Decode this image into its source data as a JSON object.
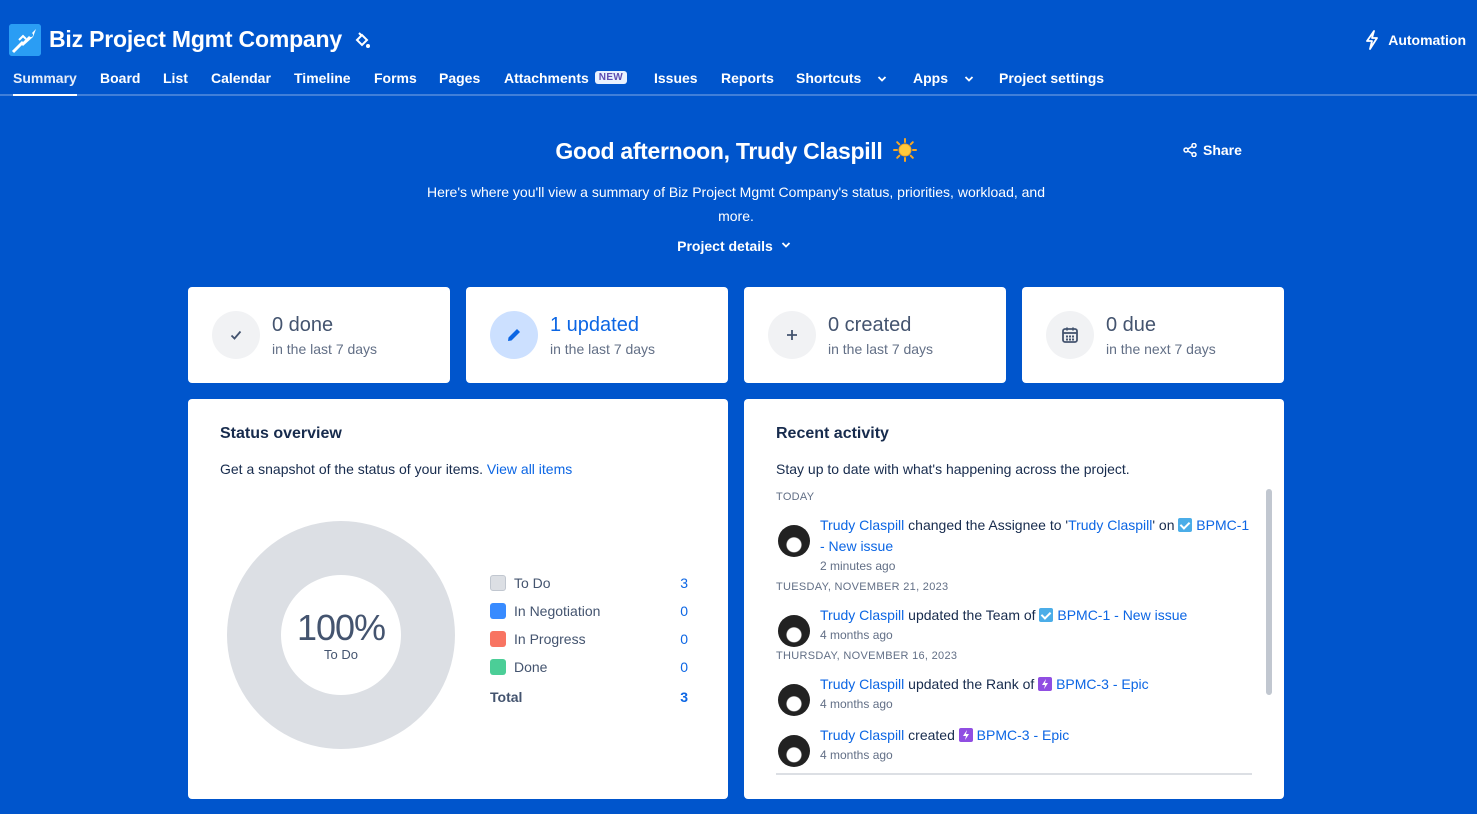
{
  "header": {
    "title": "Biz Project Mgmt Company",
    "automation_label": "Automation"
  },
  "tabs": [
    {
      "label": "Summary",
      "active": true
    },
    {
      "label": "Board"
    },
    {
      "label": "List"
    },
    {
      "label": "Calendar"
    },
    {
      "label": "Timeline"
    },
    {
      "label": "Forms"
    },
    {
      "label": "Pages"
    },
    {
      "label": "Attachments",
      "badge": "NEW"
    },
    {
      "label": "Issues"
    },
    {
      "label": "Reports"
    },
    {
      "label": "Shortcuts"
    },
    {
      "label": "Apps"
    },
    {
      "label": "Project settings"
    }
  ],
  "greeting": {
    "text": "Good afternoon, Trudy Claspill",
    "subtitle": "Here's where you'll view a summary of Biz Project Mgmt Company's status, priorities, workload, and more.",
    "share_label": "Share",
    "details_label": "Project details"
  },
  "stats": [
    {
      "value": "0 done",
      "sub": "in the last 7 days",
      "icon": "check-icon"
    },
    {
      "value": "1 updated",
      "sub": "in the last 7 days",
      "icon": "pencil-icon"
    },
    {
      "value": "0 created",
      "sub": "in the last 7 days",
      "icon": "plus-icon"
    },
    {
      "value": "0 due",
      "sub": "in the next 7 days",
      "icon": "calendar-icon"
    }
  ],
  "status_overview": {
    "title": "Status overview",
    "desc": "Get a snapshot of the status of your items.",
    "link": "View all items",
    "center_pct": "100%",
    "center_label": "To Do",
    "total_label": "Total",
    "total_value": "3"
  },
  "chart_data": {
    "type": "pie",
    "categories": [
      "To Do",
      "In Negotiation",
      "In Progress",
      "Done"
    ],
    "values": [
      3,
      0,
      0,
      0
    ],
    "colors": [
      "#DCDFE4",
      "#388BFF",
      "#F87462",
      "#4BCE97"
    ],
    "title": "Status overview"
  },
  "recent_activity": {
    "title": "Recent activity",
    "desc": "Stay up to date with what's happening across the project.",
    "sections": [
      {
        "label": "TODAY",
        "items": [
          {
            "user": "Trudy Claspill",
            "action": "changed the Assignee to '",
            "target_user": "Trudy Claspill",
            "after": "' on",
            "issue": "BPMC-1 - New issue",
            "issue_type": "task",
            "time": "2 minutes ago"
          }
        ]
      },
      {
        "label": "TUESDAY, NOVEMBER 21, 2023",
        "items": [
          {
            "user": "Trudy Claspill",
            "action": "updated the Team of",
            "issue": "BPMC-1 - New issue",
            "issue_type": "task",
            "time": "4 months ago"
          }
        ]
      },
      {
        "label": "THURSDAY, NOVEMBER 16, 2023",
        "items": [
          {
            "user": "Trudy Claspill",
            "action": "updated the Rank of",
            "issue": "BPMC-3 - Epic",
            "issue_type": "epic",
            "time": "4 months ago"
          },
          {
            "user": "Trudy Claspill",
            "action": "created",
            "issue": "BPMC-3 - Epic",
            "issue_type": "epic",
            "time": "4 months ago"
          }
        ]
      }
    ]
  }
}
